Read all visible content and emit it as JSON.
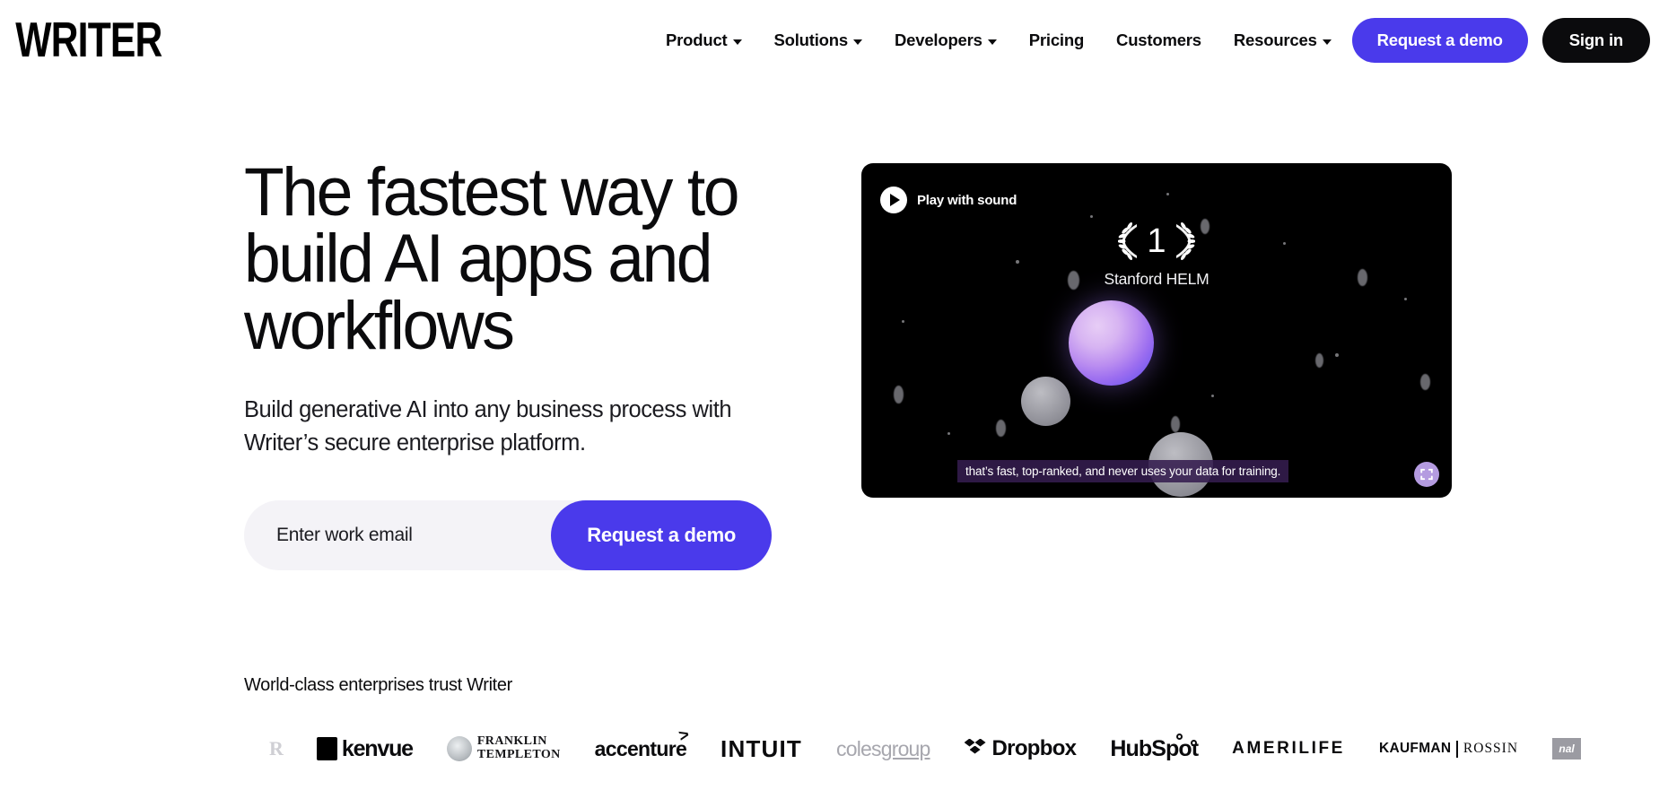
{
  "brand": {
    "logo_text": "WRITER",
    "accent_purple": "#4a3aeb",
    "dark": "#0b0b0d"
  },
  "nav": {
    "links": [
      {
        "label": "Product",
        "has_caret": true
      },
      {
        "label": "Solutions",
        "has_caret": true
      },
      {
        "label": "Developers",
        "has_caret": true
      },
      {
        "label": "Pricing",
        "has_caret": false
      },
      {
        "label": "Customers",
        "has_caret": false
      },
      {
        "label": "Resources",
        "has_caret": true
      }
    ],
    "demo_button": "Request a demo",
    "signin_button": "Sign in"
  },
  "hero": {
    "headline_line1": "The fastest way to",
    "headline_line2": "build AI apps and",
    "headline_line3": "workflows",
    "subhead_line1": "Build generative AI into any business process",
    "subhead_line2": "with Writer’s secure enterprise platform.",
    "email_placeholder": "Enter work email",
    "email_value": "",
    "form_button": "Request a demo"
  },
  "video": {
    "play_label": "Play with sound",
    "award_rank": "1",
    "award_name": "Stanford HELM",
    "caption": "that’s fast, top-ranked, and never uses your data for training.",
    "fullscreen_icon": "fullscreen-icon",
    "play_icon": "play-icon"
  },
  "social_proof": {
    "heading": "World-class enterprises trust Writer",
    "logos": [
      {
        "name": "partial-r-logo",
        "text": "R"
      },
      {
        "name": "kenvue-logo",
        "text": "kenvue"
      },
      {
        "name": "franklin-templeton-logo",
        "text_line1": "FRANKLIN",
        "text_line2": "TEMPLETON"
      },
      {
        "name": "accenture-logo",
        "text": "accenture",
        "mark": ">"
      },
      {
        "name": "intuit-logo",
        "text": "INTUIT"
      },
      {
        "name": "coles-group-logo",
        "text_a": "coles",
        "text_b": "group"
      },
      {
        "name": "dropbox-logo",
        "text": "Dropbox"
      },
      {
        "name": "hubspot-logo",
        "text": "HubSpot"
      },
      {
        "name": "amerilife-logo",
        "text": "AMERILIFE"
      },
      {
        "name": "kaufman-rossin-logo",
        "text_a": "KAUFMAN",
        "text_b": "ROSSIN"
      },
      {
        "name": "nal-logo",
        "text": "nal"
      }
    ]
  }
}
